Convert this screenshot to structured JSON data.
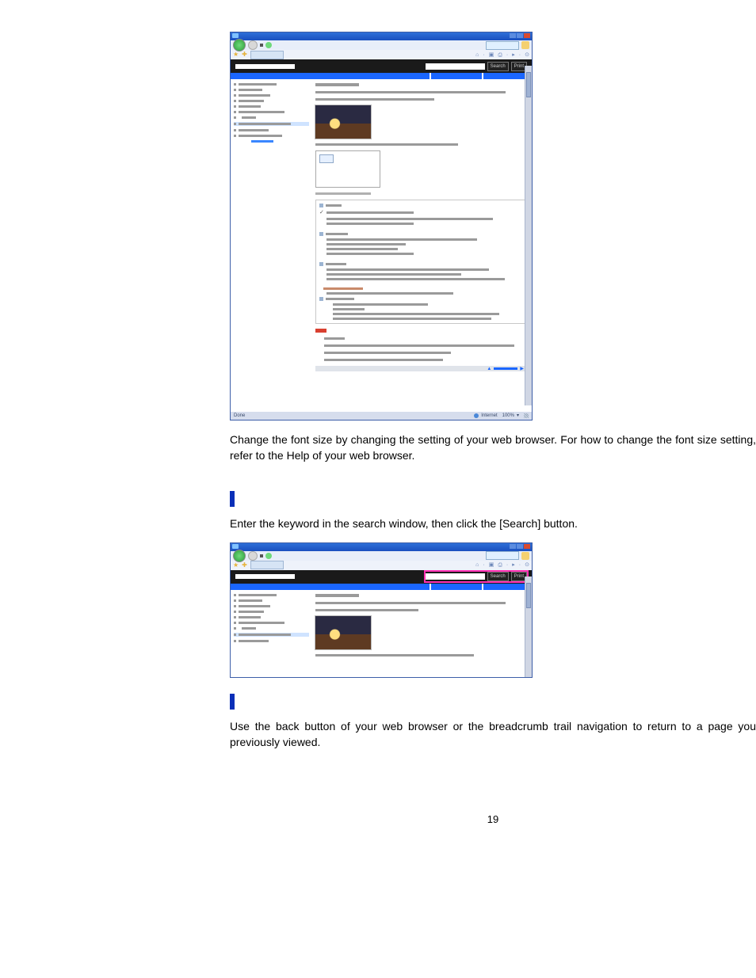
{
  "page_number": "19",
  "paragraphs": {
    "font_size": "Change the font size by changing the setting of your web browser. For how to change the font size setting, refer to the Help of your web browser.",
    "search_instr": "Enter the keyword in the search window, then click the [Search] button.",
    "back_instr": "Use the back button of your web browser or the breadcrumb trail navigation       to return to a page you previously viewed."
  },
  "browser_mock": {
    "buttons": {
      "search": "Search",
      "print": "Print"
    },
    "status": {
      "done": "Done",
      "zone": "Internet",
      "zoom": "100%"
    }
  }
}
